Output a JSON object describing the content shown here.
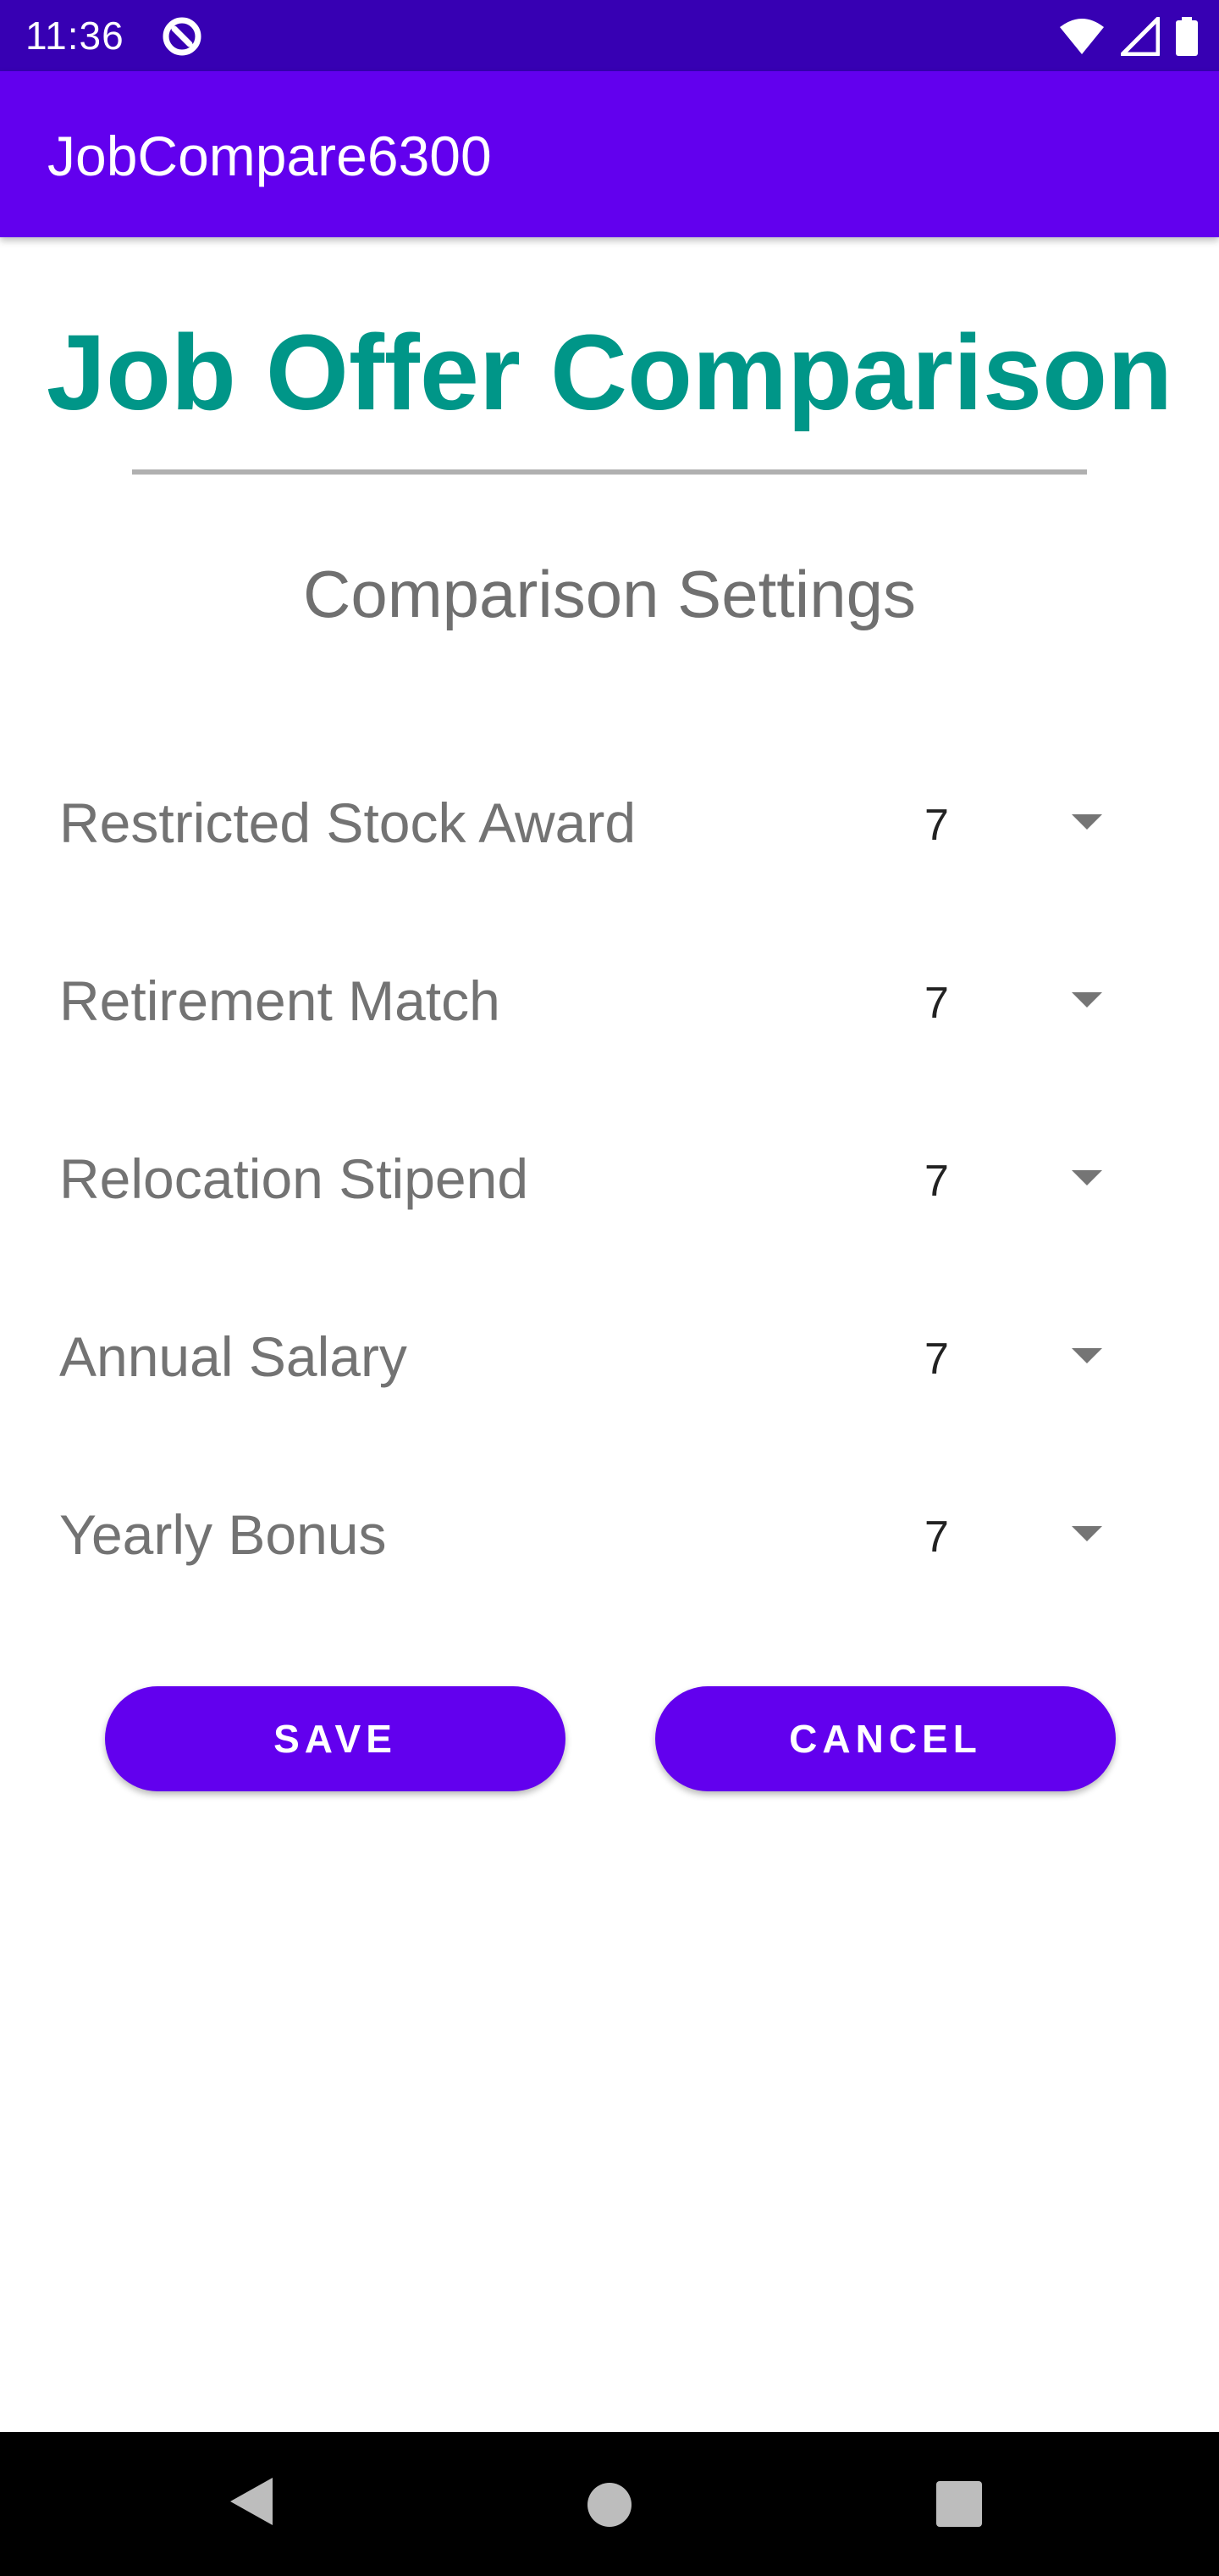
{
  "status_bar": {
    "time": "11:36",
    "icons": [
      "app-notification-icon",
      "wifi-icon",
      "cellular-signal-icon",
      "battery-icon"
    ]
  },
  "app_bar": {
    "title": "JobCompare6300"
  },
  "main": {
    "title": "Job Offer Comparison",
    "section_title": "Comparison Settings",
    "settings": [
      {
        "label": "Restricted Stock Award",
        "value": "7"
      },
      {
        "label": "Retirement Match",
        "value": "7"
      },
      {
        "label": "Relocation Stipend",
        "value": "7"
      },
      {
        "label": "Annual Salary",
        "value": "7"
      },
      {
        "label": "Yearly Bonus",
        "value": "7"
      }
    ],
    "save_label": "SAVE",
    "cancel_label": "CANCEL"
  },
  "nav_bar": {
    "icons": [
      "back-icon",
      "home-icon",
      "recents-icon"
    ]
  },
  "colors": {
    "status_bar": "#3700b3",
    "primary": "#6200ee",
    "title_teal": "#009688"
  }
}
